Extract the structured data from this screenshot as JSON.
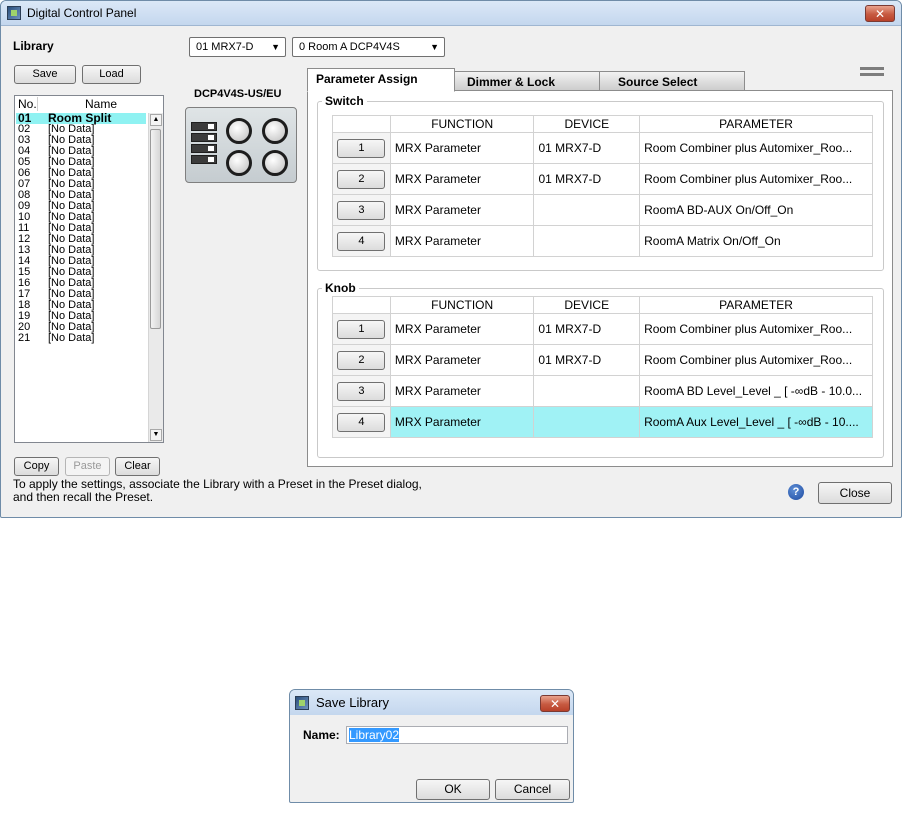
{
  "window": {
    "title": "Digital Control Panel",
    "close_glyph": "✕"
  },
  "library": {
    "label": "Library",
    "save_label": "Save",
    "load_label": "Load",
    "col_no": "No.",
    "col_name": "Name",
    "items": [
      {
        "no": "01",
        "name": "Room Split"
      },
      {
        "no": "02",
        "name": "[No Data]"
      },
      {
        "no": "03",
        "name": "[No Data]"
      },
      {
        "no": "04",
        "name": "[No Data]"
      },
      {
        "no": "05",
        "name": "[No Data]"
      },
      {
        "no": "06",
        "name": "[No Data]"
      },
      {
        "no": "07",
        "name": "[No Data]"
      },
      {
        "no": "08",
        "name": "[No Data]"
      },
      {
        "no": "09",
        "name": "[No Data]"
      },
      {
        "no": "10",
        "name": "[No Data]"
      },
      {
        "no": "11",
        "name": "[No Data]"
      },
      {
        "no": "12",
        "name": "[No Data]"
      },
      {
        "no": "13",
        "name": "[No Data]"
      },
      {
        "no": "14",
        "name": "[No Data]"
      },
      {
        "no": "15",
        "name": "[No Data]"
      },
      {
        "no": "16",
        "name": "[No Data]"
      },
      {
        "no": "17",
        "name": "[No Data]"
      },
      {
        "no": "18",
        "name": "[No Data]"
      },
      {
        "no": "19",
        "name": "[No Data]"
      },
      {
        "no": "20",
        "name": "[No Data]"
      },
      {
        "no": "21",
        "name": "[No Data]"
      }
    ],
    "copy_label": "Copy",
    "paste_label": "Paste",
    "clear_label": "Clear"
  },
  "device_select": "01 MRX7-D",
  "room_select": "0 Room A DCP4V4S",
  "device_model": "DCP4V4S-US/EU",
  "tabs": [
    "Parameter Assign",
    "Dimmer & Lock",
    "Source Select"
  ],
  "active_tab": "Parameter Assign",
  "switch_group": {
    "title": "Switch",
    "headers": [
      "FUNCTION",
      "DEVICE",
      "PARAMETER"
    ],
    "rows": [
      {
        "btn": "1",
        "function": "MRX Parameter",
        "device": "01 MRX7-D",
        "parameter": "Room Combiner plus Automixer_Roo..."
      },
      {
        "btn": "2",
        "function": "MRX Parameter",
        "device": "01 MRX7-D",
        "parameter": "Room Combiner plus Automixer_Roo..."
      },
      {
        "btn": "3",
        "function": "MRX Parameter",
        "device": "",
        "parameter": "RoomA BD-AUX On/Off_On"
      },
      {
        "btn": "4",
        "function": "MRX Parameter",
        "device": "",
        "parameter": "RoomA Matrix On/Off_On"
      }
    ]
  },
  "knob_group": {
    "title": "Knob",
    "headers": [
      "FUNCTION",
      "DEVICE",
      "PARAMETER"
    ],
    "rows": [
      {
        "btn": "1",
        "function": "MRX Parameter",
        "device": "01 MRX7-D",
        "parameter": "Room Combiner plus Automixer_Roo..."
      },
      {
        "btn": "2",
        "function": "MRX Parameter",
        "device": "01 MRX7-D",
        "parameter": "Room Combiner plus Automixer_Roo..."
      },
      {
        "btn": "3",
        "function": "MRX Parameter",
        "device": "",
        "parameter": "RoomA BD Level_Level _ [ -∞dB - 10.0..."
      },
      {
        "btn": "4",
        "function": "MRX Parameter",
        "device": "",
        "parameter": "RoomA Aux Level_Level _ [ -∞dB - 10...."
      }
    ],
    "highlight_row": 4,
    "highlight_color": "#a0f2f5"
  },
  "footer": {
    "line1": "To apply the settings, associate the Library with a Preset in the Preset dialog,",
    "line2": "and then recall the Preset.",
    "help_glyph": "?",
    "close_label": "Close"
  },
  "save_dialog": {
    "title": "Save Library",
    "name_label": "Name:",
    "name_value": "Library02",
    "ok_label": "OK",
    "cancel_label": "Cancel",
    "close_glyph": "✕"
  },
  "colors": {
    "selection": "#8ff2f2",
    "titlebar": "#c4d7ee",
    "close_button": "#c75a41"
  },
  "icons": [
    "app-icon",
    "close-icon",
    "dropdown-arrow-icon",
    "menu-icon",
    "help-icon"
  ]
}
